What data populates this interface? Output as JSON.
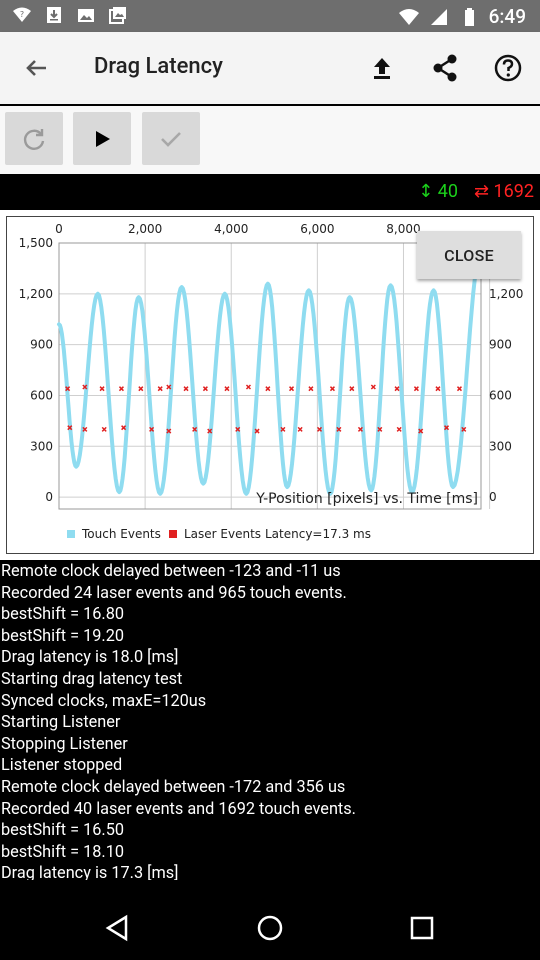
{
  "status": {
    "time": "6:49"
  },
  "appbar": {
    "title": "Drag Latency",
    "icons": [
      "back-arrow-icon",
      "upload-icon",
      "share-icon",
      "help-icon"
    ]
  },
  "toolbar": {
    "buttons": [
      "refresh-icon",
      "play-icon",
      "check-icon"
    ]
  },
  "stats": {
    "laser_events": "↕ 40",
    "touch_events": "⇄ 1692"
  },
  "chart": {
    "close_label": "CLOSE",
    "annotation": "Y-Position [pixels] vs. Time [ms]",
    "legend_touch": "Touch Events",
    "legend_laser": "Laser Events",
    "legend_latency": "Latency=17.3 ms"
  },
  "chart_data": {
    "type": "line",
    "x_top_ticks": [
      "0",
      "2,000",
      "4,000",
      "6,000",
      "8,000"
    ],
    "y_left_ticks": [
      "0",
      "300",
      "600",
      "900",
      "1,200",
      "1,500"
    ],
    "y_right_ticks": [
      "0",
      "300",
      "600",
      "900",
      "1,200"
    ],
    "xlim": [
      0,
      9800
    ],
    "ylim": [
      -70,
      1500
    ],
    "series": [
      {
        "name": "Touch Events",
        "color": "#8fdcf0",
        "peaks": [
          [
            0,
            1020
          ],
          [
            400,
            180
          ],
          [
            900,
            1200
          ],
          [
            1400,
            30
          ],
          [
            1850,
            1180
          ],
          [
            2350,
            20
          ],
          [
            2850,
            1240
          ],
          [
            3350,
            80
          ],
          [
            3850,
            1200
          ],
          [
            4350,
            20
          ],
          [
            4850,
            1260
          ],
          [
            5300,
            60
          ],
          [
            5800,
            1220
          ],
          [
            6300,
            20
          ],
          [
            6750,
            1180
          ],
          [
            7250,
            40
          ],
          [
            7700,
            1250
          ],
          [
            8200,
            30
          ],
          [
            8700,
            1220
          ],
          [
            9150,
            60
          ],
          [
            9800,
            1450
          ]
        ]
      },
      {
        "name": "Laser Events",
        "color": "#e02020",
        "points": [
          [
            200,
            640
          ],
          [
            600,
            650
          ],
          [
            1000,
            640
          ],
          [
            1450,
            640
          ],
          [
            1900,
            640
          ],
          [
            2350,
            640
          ],
          [
            2550,
            650
          ],
          [
            2950,
            640
          ],
          [
            3400,
            640
          ],
          [
            3900,
            640
          ],
          [
            4400,
            650
          ],
          [
            4850,
            640
          ],
          [
            5400,
            640
          ],
          [
            5850,
            640
          ],
          [
            6350,
            640
          ],
          [
            6800,
            640
          ],
          [
            7300,
            650
          ],
          [
            7850,
            640
          ],
          [
            8300,
            640
          ],
          [
            8800,
            640
          ],
          [
            9300,
            640
          ],
          [
            250,
            410
          ],
          [
            600,
            400
          ],
          [
            1050,
            400
          ],
          [
            1500,
            410
          ],
          [
            2150,
            400
          ],
          [
            2550,
            390
          ],
          [
            3150,
            400
          ],
          [
            3500,
            390
          ],
          [
            4150,
            400
          ],
          [
            4600,
            390
          ],
          [
            5200,
            400
          ],
          [
            5600,
            400
          ],
          [
            6050,
            400
          ],
          [
            6500,
            400
          ],
          [
            7000,
            400
          ],
          [
            7450,
            400
          ],
          [
            7900,
            400
          ],
          [
            8400,
            390
          ],
          [
            9000,
            410
          ],
          [
            9400,
            400
          ]
        ]
      }
    ]
  },
  "log": [
    "Remote clock delayed between -123 and -11 us",
    "Recorded 24 laser events and 965 touch events.",
    "bestShift = 16.80",
    "bestShift = 19.20",
    "Drag latency is 18.0 [ms]",
    "Starting drag latency test",
    "Synced clocks, maxE=120us",
    "Starting Listener",
    "Stopping Listener",
    "Listener stopped",
    "Remote clock delayed between -172 and 356 us",
    "Recorded 40 laser events and 1692 touch events.",
    "bestShift = 16.50",
    "bestShift = 18.10",
    "Drag latency is 17.3 [ms]"
  ],
  "navbar": [
    "back-nav-icon",
    "home-nav-icon",
    "recents-nav-icon"
  ]
}
